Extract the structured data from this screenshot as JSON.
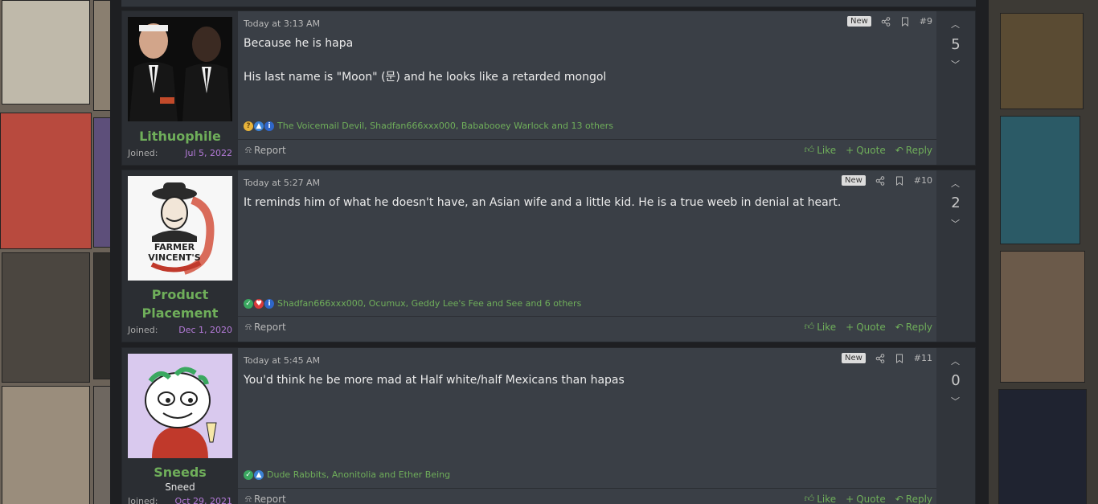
{
  "posts": [
    {
      "username": "Lithuophile",
      "user_title": "",
      "joined_label": "Joined:",
      "joined_date": "Jul 5, 2022",
      "date": "Today at 3:13 AM",
      "badge": "New",
      "post_number": "#9",
      "body": [
        "Because he is hapa",
        "His last name is \"Moon\" (문) and he looks like a retarded mongol"
      ],
      "reactions_text": "The Voicemail Devil, Shadfan666xxx000, Bababooey Warlock and 13 others",
      "reaction_icons": [
        "thinking-reaction",
        "like-reaction",
        "info-reaction"
      ],
      "score": "5"
    },
    {
      "username": "Product Placement",
      "user_title": "",
      "joined_label": "Joined:",
      "joined_date": "Dec 1, 2020",
      "date": "Today at 5:27 AM",
      "badge": "New",
      "post_number": "#10",
      "body": [
        "It reminds him of what he doesn't have, an Asian wife and a little kid. He is a true weeb in denial at heart."
      ],
      "reactions_text": "Shadfan666xxx000, Ocumux, Geddy Lee's Fee and See and 6 others",
      "reaction_icons": [
        "agree-reaction",
        "heart-reaction",
        "info-reaction"
      ],
      "score": "2",
      "avatar_text": "FARMER VINCENT'S"
    },
    {
      "username": "Sneeds",
      "user_title": "Sneed",
      "joined_label": "Joined:",
      "joined_date": "Oct 29, 2021",
      "date": "Today at 5:45 AM",
      "badge": "New",
      "post_number": "#11",
      "body": [
        "You'd think he be more mad at Half white/half Mexicans than hapas"
      ],
      "reactions_text": "Dude Rabbits, Anonitolia and Ether Being",
      "reaction_icons": [
        "agree-reaction",
        "like-reaction"
      ],
      "score": "0"
    }
  ],
  "labels": {
    "report": "Report",
    "like": "Like",
    "quote": "Quote",
    "reply": "Reply"
  },
  "colors": {
    "accent_green": "#6fae5a",
    "joined_date": "#b47ad8",
    "post_bg": "#3a3f46"
  }
}
